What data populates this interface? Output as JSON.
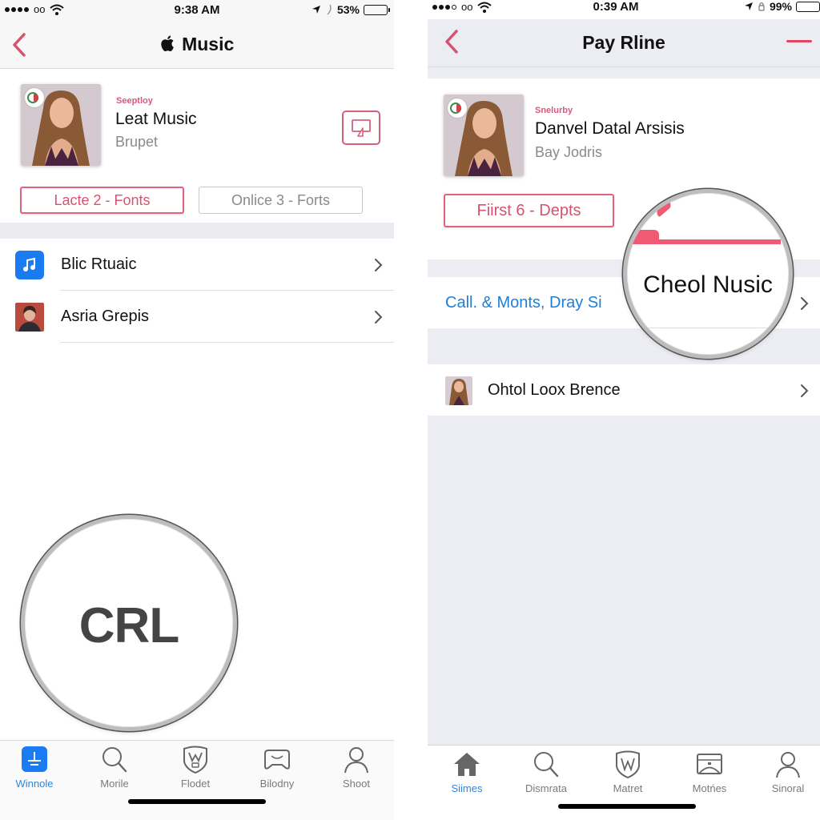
{
  "left": {
    "status": {
      "carrier": "oo",
      "time": "9:38 AM",
      "battery": "53%",
      "battery_fraction": 0.53
    },
    "nav": {
      "title": "Music",
      "back": "back"
    },
    "hero": {
      "kicker": "Seeptloy",
      "title": "Leat Music",
      "subtitle": "Brupet",
      "pills": [
        {
          "label": "Lacte 2 - Fonts",
          "active": true
        },
        {
          "label": "Onlice 3 - Forts",
          "active": false
        }
      ]
    },
    "list": [
      {
        "label": "Blic Rtuaic",
        "icon": "music-note-icon"
      },
      {
        "label": "Asria Grepis",
        "icon": "avatar-thumbnail"
      }
    ],
    "magnifier": {
      "text": "CRL"
    },
    "tabs": [
      {
        "label": "Winnole",
        "icon": "download-icon",
        "active": true
      },
      {
        "label": "Morile",
        "icon": "search-icon",
        "active": false
      },
      {
        "label": "Flodet",
        "icon": "shield-icon",
        "active": false
      },
      {
        "label": "Bilodny",
        "icon": "gamepad-icon",
        "active": false
      },
      {
        "label": "Shoot",
        "icon": "person-icon",
        "active": false
      }
    ]
  },
  "right": {
    "status": {
      "carrier": "oo",
      "time": "0:39 AM",
      "battery": "99%",
      "battery_fraction": 0.9
    },
    "nav": {
      "title": "Pay Rline",
      "back": "back"
    },
    "hero": {
      "kicker": "Snelurby",
      "title": "Danvel Datal Arsisis",
      "subtitle": "Bay Jodris",
      "pills": [
        {
          "label": "Fiirst 6 - Depts",
          "active": true
        }
      ]
    },
    "list": [
      {
        "label": "Call. & Monts, Dray Si",
        "style": "link"
      },
      {
        "label": "Ohtol Loox Brence",
        "icon": "avatar-thumbnail"
      }
    ],
    "magnifier": {
      "text": "Cheol Nusic"
    },
    "tabs": [
      {
        "label": "Siimes",
        "icon": "home-icon",
        "active": true
      },
      {
        "label": "Dismrata",
        "icon": "search-icon",
        "active": false
      },
      {
        "label": "Matret",
        "icon": "shield-icon",
        "active": false
      },
      {
        "label": "Motńes",
        "icon": "device-icon",
        "active": false
      },
      {
        "label": "Sinoral",
        "icon": "person-icon",
        "active": false
      }
    ]
  },
  "colors": {
    "accent_pink": "#e0627c",
    "link_blue": "#1e7fd6",
    "tab_active_blue": "#2f87d8",
    "music_tile_blue": "#1a7cf0"
  }
}
